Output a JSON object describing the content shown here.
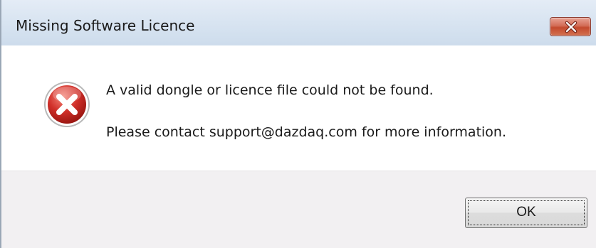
{
  "window": {
    "title": "Missing Software Licence",
    "close_icon": "close-x-icon"
  },
  "message": {
    "icon": "error-icon",
    "line1": "A valid dongle or licence file could not be found.",
    "line2": "Please contact support@dazdaq.com for more information."
  },
  "buttons": {
    "ok_label": "OK"
  },
  "colors": {
    "close_button": "#c44a2e",
    "error_icon": "#d1302a"
  }
}
